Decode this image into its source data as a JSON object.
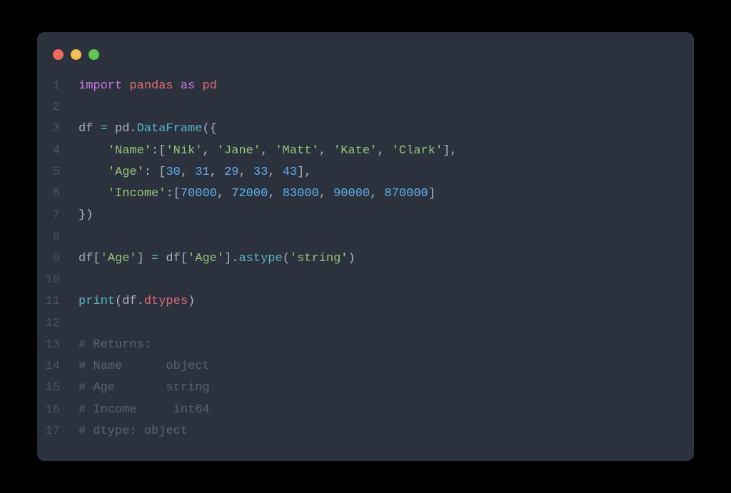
{
  "window": {
    "dots": [
      "close",
      "minimize",
      "zoom"
    ]
  },
  "code": {
    "lines": [
      {
        "n": 1,
        "tokens": [
          {
            "c": "kw",
            "t": "import"
          },
          {
            "c": "id",
            "t": " "
          },
          {
            "c": "mod",
            "t": "pandas"
          },
          {
            "c": "id",
            "t": " "
          },
          {
            "c": "kw",
            "t": "as"
          },
          {
            "c": "id",
            "t": " "
          },
          {
            "c": "mod",
            "t": "pd"
          }
        ]
      },
      {
        "n": 2,
        "tokens": []
      },
      {
        "n": 3,
        "tokens": [
          {
            "c": "id",
            "t": "df "
          },
          {
            "c": "op",
            "t": "="
          },
          {
            "c": "id",
            "t": " pd."
          },
          {
            "c": "fn",
            "t": "DataFrame"
          },
          {
            "c": "id",
            "t": "({"
          }
        ]
      },
      {
        "n": 4,
        "tokens": [
          {
            "c": "id",
            "t": "    "
          },
          {
            "c": "str",
            "t": "'Name'"
          },
          {
            "c": "id",
            "t": ":["
          },
          {
            "c": "str",
            "t": "'Nik'"
          },
          {
            "c": "id",
            "t": ", "
          },
          {
            "c": "str",
            "t": "'Jane'"
          },
          {
            "c": "id",
            "t": ", "
          },
          {
            "c": "str",
            "t": "'Matt'"
          },
          {
            "c": "id",
            "t": ", "
          },
          {
            "c": "str",
            "t": "'Kate'"
          },
          {
            "c": "id",
            "t": ", "
          },
          {
            "c": "str",
            "t": "'Clark'"
          },
          {
            "c": "id",
            "t": "],"
          }
        ]
      },
      {
        "n": 5,
        "tokens": [
          {
            "c": "id",
            "t": "    "
          },
          {
            "c": "str",
            "t": "'Age'"
          },
          {
            "c": "id",
            "t": ": ["
          },
          {
            "c": "num",
            "t": "30"
          },
          {
            "c": "id",
            "t": ", "
          },
          {
            "c": "num",
            "t": "31"
          },
          {
            "c": "id",
            "t": ", "
          },
          {
            "c": "num",
            "t": "29"
          },
          {
            "c": "id",
            "t": ", "
          },
          {
            "c": "num",
            "t": "33"
          },
          {
            "c": "id",
            "t": ", "
          },
          {
            "c": "num",
            "t": "43"
          },
          {
            "c": "id",
            "t": "],"
          }
        ]
      },
      {
        "n": 6,
        "tokens": [
          {
            "c": "id",
            "t": "    "
          },
          {
            "c": "str",
            "t": "'Income'"
          },
          {
            "c": "id",
            "t": ":["
          },
          {
            "c": "num",
            "t": "70000"
          },
          {
            "c": "id",
            "t": ", "
          },
          {
            "c": "num",
            "t": "72000"
          },
          {
            "c": "id",
            "t": ", "
          },
          {
            "c": "num",
            "t": "83000"
          },
          {
            "c": "id",
            "t": ", "
          },
          {
            "c": "num",
            "t": "90000"
          },
          {
            "c": "id",
            "t": ", "
          },
          {
            "c": "num",
            "t": "870000"
          },
          {
            "c": "id",
            "t": "]"
          }
        ]
      },
      {
        "n": 7,
        "tokens": [
          {
            "c": "id",
            "t": "})"
          }
        ]
      },
      {
        "n": 8,
        "tokens": []
      },
      {
        "n": 9,
        "tokens": [
          {
            "c": "id",
            "t": "df["
          },
          {
            "c": "str",
            "t": "'Age'"
          },
          {
            "c": "id",
            "t": "] "
          },
          {
            "c": "op",
            "t": "="
          },
          {
            "c": "id",
            "t": " df["
          },
          {
            "c": "str",
            "t": "'Age'"
          },
          {
            "c": "id",
            "t": "]."
          },
          {
            "c": "fn",
            "t": "astype"
          },
          {
            "c": "id",
            "t": "("
          },
          {
            "c": "str",
            "t": "'string'"
          },
          {
            "c": "id",
            "t": ")"
          }
        ]
      },
      {
        "n": 10,
        "tokens": []
      },
      {
        "n": 11,
        "tokens": [
          {
            "c": "fn",
            "t": "print"
          },
          {
            "c": "id",
            "t": "(df."
          },
          {
            "c": "attr",
            "t": "dtypes"
          },
          {
            "c": "id",
            "t": ")"
          }
        ]
      },
      {
        "n": 12,
        "tokens": []
      },
      {
        "n": 13,
        "tokens": [
          {
            "c": "cmt",
            "t": "# Returns:"
          }
        ]
      },
      {
        "n": 14,
        "tokens": [
          {
            "c": "cmt",
            "t": "# Name      object"
          }
        ]
      },
      {
        "n": 15,
        "tokens": [
          {
            "c": "cmt",
            "t": "# Age       string"
          }
        ]
      },
      {
        "n": 16,
        "tokens": [
          {
            "c": "cmt",
            "t": "# Income     int64"
          }
        ]
      },
      {
        "n": 17,
        "tokens": [
          {
            "c": "cmt",
            "t": "# dtype: object"
          }
        ]
      }
    ]
  }
}
